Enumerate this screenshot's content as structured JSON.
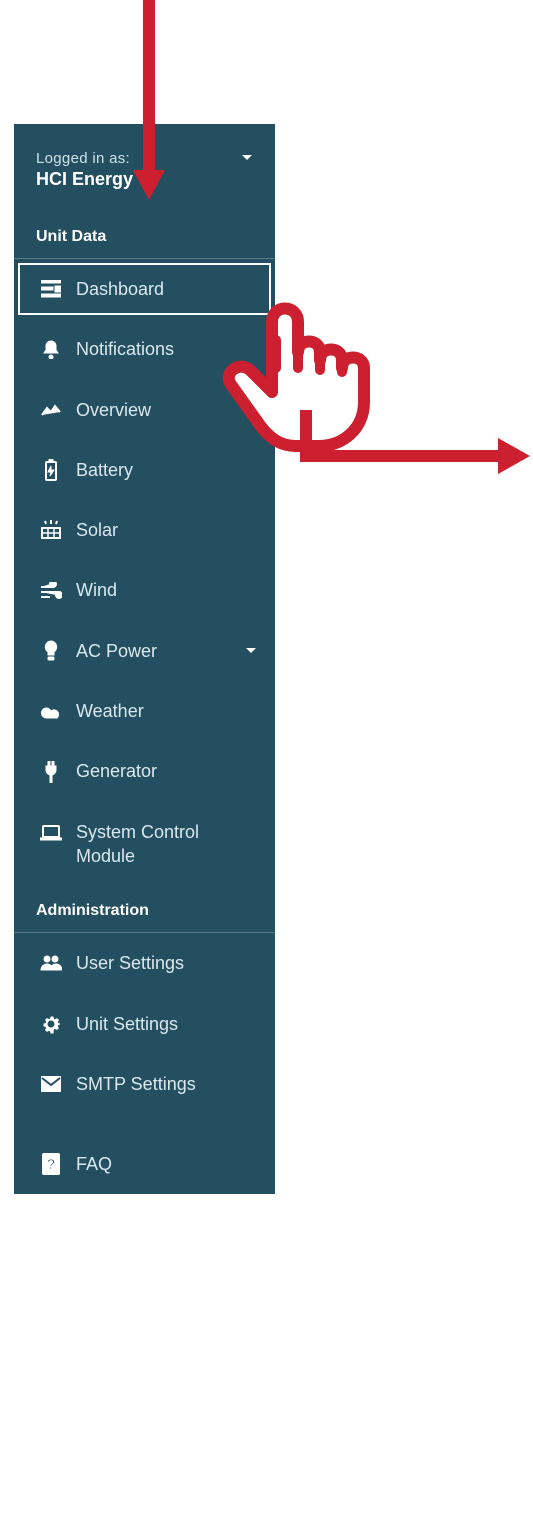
{
  "user": {
    "label": "Logged in as:",
    "name": "HCI Energy"
  },
  "sections": {
    "unit_data": {
      "title": "Unit Data",
      "items": [
        "Dashboard",
        "Notifications",
        "Overview",
        "Battery",
        "Solar",
        "Wind",
        "AC Power",
        "Weather",
        "Generator",
        "System Control Module"
      ]
    },
    "admin": {
      "title": "Administration",
      "items": [
        "User Settings",
        "Unit Settings",
        "SMTP Settings",
        "FAQ"
      ]
    }
  }
}
